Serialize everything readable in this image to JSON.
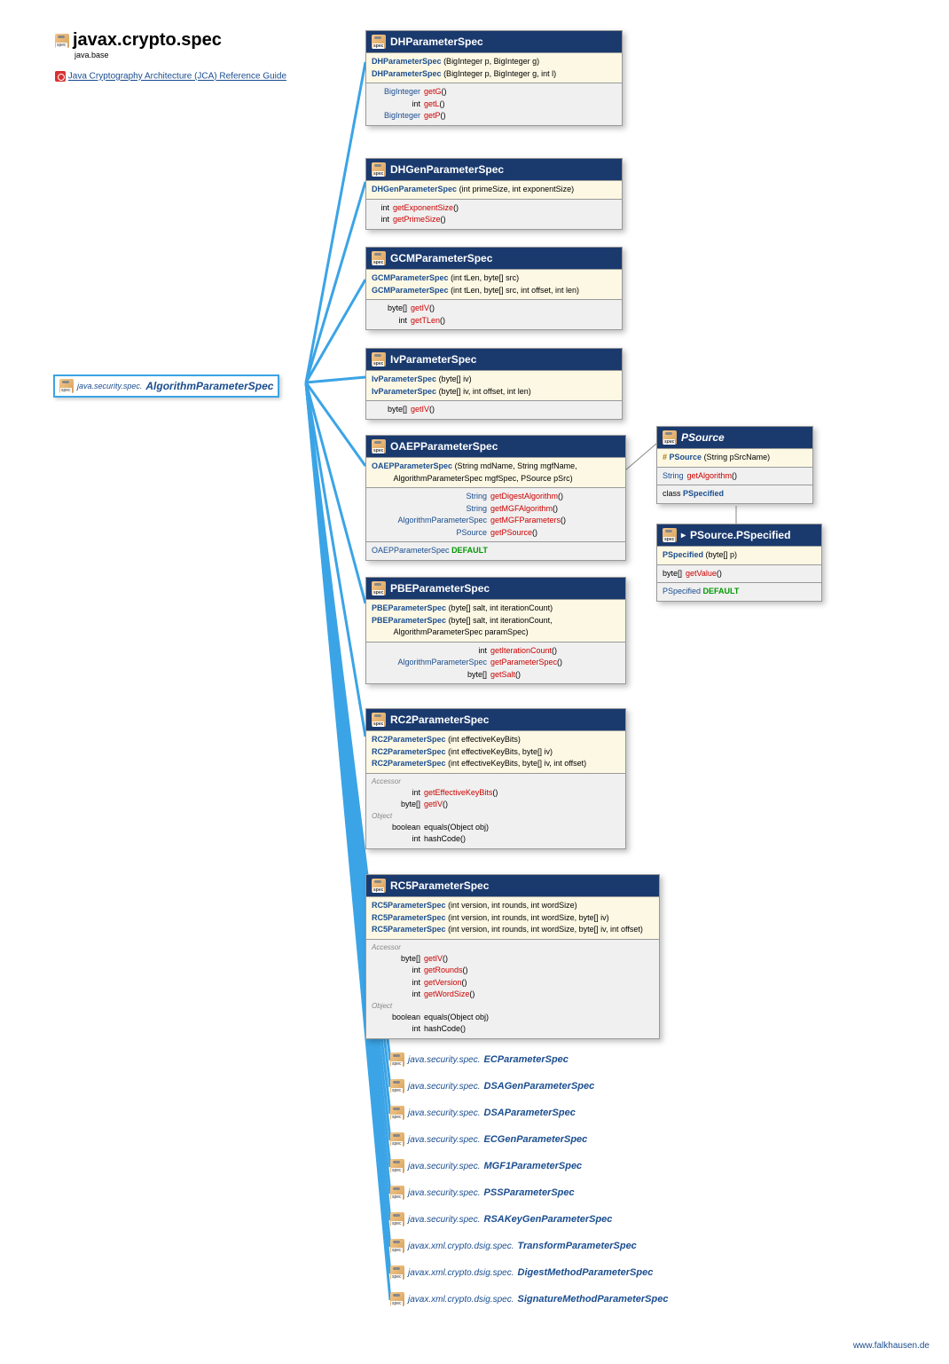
{
  "package": {
    "name": "javax.crypto.spec",
    "module": "java.base"
  },
  "reference": {
    "label": "Java Cryptography Architecture (JCA) Reference Guide"
  },
  "root_interface": {
    "package": "java.security.spec.",
    "name": "AlgorithmParameterSpec"
  },
  "classes": {
    "dh": {
      "name": "DHParameterSpec",
      "ctors": [
        {
          "name": "DHParameterSpec",
          "sig": "(BigInteger p, BigInteger g)"
        },
        {
          "name": "DHParameterSpec",
          "sig": "(BigInteger p, BigInteger g, int l)"
        }
      ],
      "methods": [
        {
          "ret": "BigInteger",
          "name": "getG",
          "sig": "()"
        },
        {
          "ret": "int",
          "name": "getL",
          "sig": "()"
        },
        {
          "ret": "BigInteger",
          "name": "getP",
          "sig": "()"
        }
      ]
    },
    "dhgen": {
      "name": "DHGenParameterSpec",
      "ctors": [
        {
          "name": "DHGenParameterSpec",
          "sig": "(int primeSize, int exponentSize)"
        }
      ],
      "methods": [
        {
          "ret": "int",
          "name": "getExponentSize",
          "sig": "()"
        },
        {
          "ret": "int",
          "name": "getPrimeSize",
          "sig": "()"
        }
      ]
    },
    "gcm": {
      "name": "GCMParameterSpec",
      "ctors": [
        {
          "name": "GCMParameterSpec",
          "sig": "(int tLen, byte[] src)"
        },
        {
          "name": "GCMParameterSpec",
          "sig": "(int tLen, byte[] src, int offset, int len)"
        }
      ],
      "methods": [
        {
          "ret": "byte[]",
          "name": "getIV",
          "sig": "()"
        },
        {
          "ret": "int",
          "name": "getTLen",
          "sig": "()"
        }
      ]
    },
    "iv": {
      "name": "IvParameterSpec",
      "ctors": [
        {
          "name": "IvParameterSpec",
          "sig": "(byte[] iv)"
        },
        {
          "name": "IvParameterSpec",
          "sig": "(byte[] iv, int offset, int len)"
        }
      ],
      "methods": [
        {
          "ret": "byte[]",
          "name": "getIV",
          "sig": "()"
        }
      ]
    },
    "oaep": {
      "name": "OAEPParameterSpec",
      "ctors": [
        {
          "name": "OAEPParameterSpec",
          "sig": "(String mdName, String mgfName,\n          AlgorithmParameterSpec mgfSpec, PSource pSrc)"
        }
      ],
      "methods": [
        {
          "ret": "String",
          "name": "getDigestAlgorithm",
          "sig": "()"
        },
        {
          "ret": "String",
          "name": "getMGFAlgorithm",
          "sig": "()"
        },
        {
          "ret": "AlgorithmParameterSpec",
          "name": "getMGFParameters",
          "sig": "()"
        },
        {
          "ret": "PSource",
          "name": "getPSource",
          "sig": "()"
        }
      ],
      "const": "DEFAULT",
      "const_type": "OAEPParameterSpec"
    },
    "pbe": {
      "name": "PBEParameterSpec",
      "ctors": [
        {
          "name": "PBEParameterSpec",
          "sig": "(byte[] salt, int iterationCount)"
        },
        {
          "name": "PBEParameterSpec",
          "sig": "(byte[] salt, int iterationCount,\n          AlgorithmParameterSpec paramSpec)"
        }
      ],
      "methods": [
        {
          "ret": "int",
          "name": "getIterationCount",
          "sig": "()"
        },
        {
          "ret": "AlgorithmParameterSpec",
          "name": "getParameterSpec",
          "sig": "()"
        },
        {
          "ret": "byte[]",
          "name": "getSalt",
          "sig": "()"
        }
      ]
    },
    "rc2": {
      "name": "RC2ParameterSpec",
      "ctors": [
        {
          "name": "RC2ParameterSpec",
          "sig": "(int effectiveKeyBits)"
        },
        {
          "name": "RC2ParameterSpec",
          "sig": "(int effectiveKeyBits, byte[] iv)"
        },
        {
          "name": "RC2ParameterSpec",
          "sig": "(int effectiveKeyBits, byte[] iv, int offset)"
        }
      ],
      "accessor_label": "Accessor",
      "accessors": [
        {
          "ret": "int",
          "name": "getEffectiveKeyBits",
          "sig": "()"
        },
        {
          "ret": "byte[]",
          "name": "getIV",
          "sig": "()"
        }
      ],
      "object_label": "Object",
      "object_methods": [
        {
          "ret": "boolean",
          "name": "equals",
          "sig": "(Object obj)",
          "plain": true
        },
        {
          "ret": "int",
          "name": "hashCode",
          "sig": "()",
          "plain": true
        }
      ]
    },
    "rc5": {
      "name": "RC5ParameterSpec",
      "ctors": [
        {
          "name": "RC5ParameterSpec",
          "sig": "(int version, int rounds, int wordSize)"
        },
        {
          "name": "RC5ParameterSpec",
          "sig": "(int version, int rounds, int wordSize, byte[] iv)"
        },
        {
          "name": "RC5ParameterSpec",
          "sig": "(int version, int rounds, int wordSize, byte[] iv, int offset)"
        }
      ],
      "accessor_label": "Accessor",
      "accessors": [
        {
          "ret": "byte[]",
          "name": "getIV",
          "sig": "()"
        },
        {
          "ret": "int",
          "name": "getRounds",
          "sig": "()"
        },
        {
          "ret": "int",
          "name": "getVersion",
          "sig": "()"
        },
        {
          "ret": "int",
          "name": "getWordSize",
          "sig": "()"
        }
      ],
      "object_label": "Object",
      "object_methods": [
        {
          "ret": "boolean",
          "name": "equals",
          "sig": "(Object obj)",
          "plain": true
        },
        {
          "ret": "int",
          "name": "hashCode",
          "sig": "()",
          "plain": true
        }
      ]
    },
    "psource": {
      "name": "PSource",
      "ctors": [
        {
          "name": "PSource",
          "sig": "(String pSrcName)",
          "protected": true
        }
      ],
      "methods": [
        {
          "ret": "String",
          "name": "getAlgorithm",
          "sig": "()"
        }
      ],
      "inner": {
        "label": "class",
        "name": "PSpecified"
      }
    },
    "pspec": {
      "name": "PSource.PSpecified",
      "short": "PSpecified",
      "ctors": [
        {
          "name": "PSpecified",
          "sig": "(byte[] p)"
        }
      ],
      "methods": [
        {
          "ret": "byte[]",
          "name": "getValue",
          "sig": "()"
        }
      ],
      "const": "DEFAULT",
      "const_type": "PSpecified"
    }
  },
  "refs": [
    {
      "pkg": "java.security.spec.",
      "name": "ECParameterSpec"
    },
    {
      "pkg": "java.security.spec.",
      "name": "DSAGenParameterSpec"
    },
    {
      "pkg": "java.security.spec.",
      "name": "DSAParameterSpec"
    },
    {
      "pkg": "java.security.spec.",
      "name": "ECGenParameterSpec"
    },
    {
      "pkg": "java.security.spec.",
      "name": "MGF1ParameterSpec"
    },
    {
      "pkg": "java.security.spec.",
      "name": "PSSParameterSpec"
    },
    {
      "pkg": "java.security.spec.",
      "name": "RSAKeyGenParameterSpec"
    },
    {
      "pkg": "javax.xml.crypto.dsig.spec.",
      "name": "TransformParameterSpec"
    },
    {
      "pkg": "javax.xml.crypto.dsig.spec.",
      "name": "DigestMethodParameterSpec"
    },
    {
      "pkg": "javax.xml.crypto.dsig.spec.",
      "name": "SignatureMethodParameterSpec"
    }
  ],
  "footer": "www.falkhausen.de"
}
